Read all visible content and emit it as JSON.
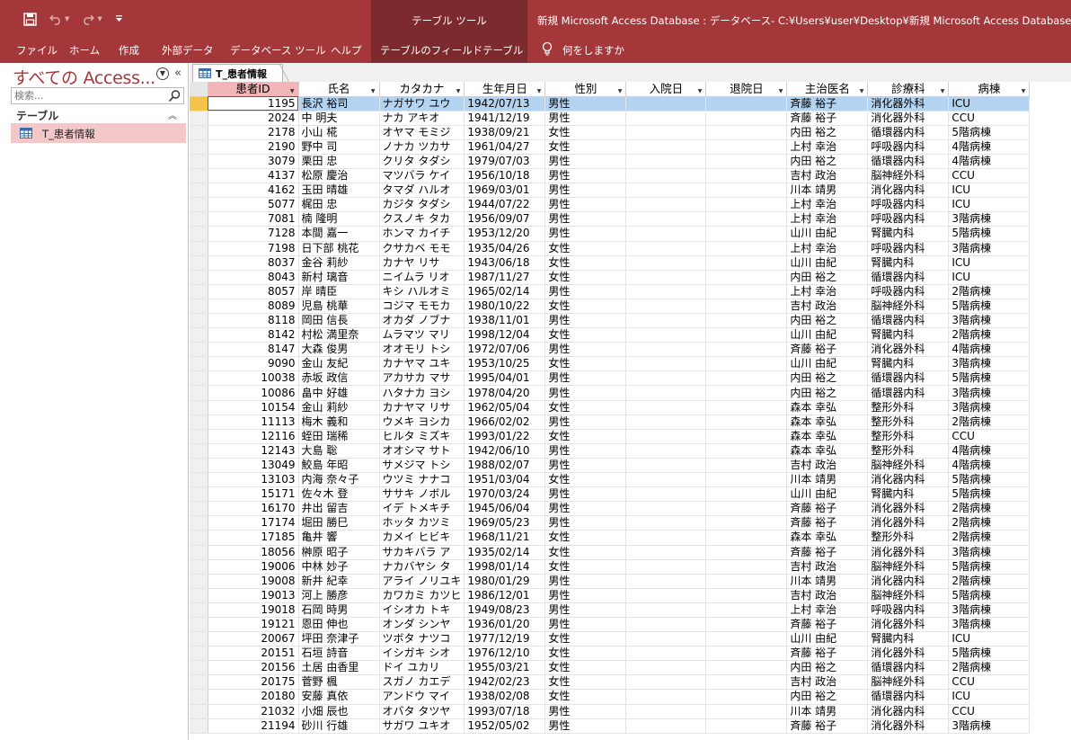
{
  "titlebar": {
    "context_title": "テーブル ツール",
    "window_title": "新規 Microsoft Access Database : データベース- C:¥Users¥user¥Desktop¥新規 Microsoft Access Database.accdb"
  },
  "ribbon": {
    "tabs": [
      "ファイル",
      "ホーム",
      "作成",
      "外部データ",
      "データベース ツール",
      "ヘルプ",
      "テーブルのフィールド",
      "テーブル"
    ],
    "tell_me": "何をしますか"
  },
  "nav": {
    "title": "すべての Access...",
    "search_placeholder": "検索...",
    "group_label": "テーブル",
    "items": [
      {
        "label": "T_患者情報"
      }
    ]
  },
  "document": {
    "tab_label": "T_患者情報"
  },
  "grid": {
    "columns": [
      {
        "label": "患者ID"
      },
      {
        "label": "氏名"
      },
      {
        "label": "カタカナ"
      },
      {
        "label": "生年月日"
      },
      {
        "label": "性別"
      },
      {
        "label": "入院日"
      },
      {
        "label": "退院日"
      },
      {
        "label": "主治医名"
      },
      {
        "label": "診療科"
      },
      {
        "label": "病棟"
      }
    ],
    "rows": [
      [
        "1195",
        "長沢 裕司",
        "ナガサワ ユウ",
        "1942/07/13",
        "男性",
        "",
        "",
        "斉藤 裕子",
        "消化器外科",
        "ICU"
      ],
      [
        "2024",
        "中 明夫",
        "ナカ アキオ",
        "1941/12/19",
        "男性",
        "",
        "",
        "斉藤 裕子",
        "消化器外科",
        "CCU"
      ],
      [
        "2178",
        "小山 椛",
        "オヤマ モミジ",
        "1938/09/21",
        "女性",
        "",
        "",
        "内田 裕之",
        "循環器内科",
        "5階病棟"
      ],
      [
        "2190",
        "野中 司",
        "ノナカ ツカサ",
        "1961/04/27",
        "女性",
        "",
        "",
        "上村 幸治",
        "呼吸器内科",
        "4階病棟"
      ],
      [
        "3079",
        "栗田 忠",
        "クリタ タダシ",
        "1979/07/03",
        "男性",
        "",
        "",
        "内田 裕之",
        "循環器内科",
        "4階病棟"
      ],
      [
        "4137",
        "松原 慶治",
        "マツバラ ケイ",
        "1956/10/18",
        "男性",
        "",
        "",
        "吉村 政治",
        "脳神経外科",
        "CCU"
      ],
      [
        "4162",
        "玉田 晴雄",
        "タマダ ハルオ",
        "1969/03/01",
        "男性",
        "",
        "",
        "川本 靖男",
        "消化器内科",
        "ICU"
      ],
      [
        "5077",
        "梶田 忠",
        "カジタ タダシ",
        "1944/07/22",
        "男性",
        "",
        "",
        "上村 幸治",
        "呼吸器内科",
        "ICU"
      ],
      [
        "7081",
        "楠 隆明",
        "クスノキ タカ",
        "1956/09/07",
        "男性",
        "",
        "",
        "上村 幸治",
        "呼吸器内科",
        "3階病棟"
      ],
      [
        "7128",
        "本間 嘉一",
        "ホンマ カイチ",
        "1953/12/20",
        "男性",
        "",
        "",
        "山川 由紀",
        "腎臓内科",
        "5階病棟"
      ],
      [
        "7198",
        "日下部 桃花",
        "クサカベ モモ",
        "1935/04/26",
        "女性",
        "",
        "",
        "上村 幸治",
        "呼吸器内科",
        "3階病棟"
      ],
      [
        "8037",
        "金谷 莉紗",
        "カナヤ リサ",
        "1943/06/18",
        "女性",
        "",
        "",
        "山川 由紀",
        "腎臓内科",
        "ICU"
      ],
      [
        "8043",
        "新村 璃音",
        "ニイムラ リオ",
        "1987/11/27",
        "女性",
        "",
        "",
        "内田 裕之",
        "循環器内科",
        "ICU"
      ],
      [
        "8057",
        "岸 晴臣",
        "キシ ハルオミ",
        "1965/02/14",
        "男性",
        "",
        "",
        "上村 幸治",
        "呼吸器内科",
        "2階病棟"
      ],
      [
        "8089",
        "児島 桃華",
        "コジマ モモカ",
        "1980/10/22",
        "女性",
        "",
        "",
        "吉村 政治",
        "脳神経外科",
        "5階病棟"
      ],
      [
        "8118",
        "岡田 信長",
        "オカダ ノブナ",
        "1938/11/01",
        "男性",
        "",
        "",
        "内田 裕之",
        "循環器内科",
        "3階病棟"
      ],
      [
        "8142",
        "村松 満里奈",
        "ムラマツ マリ",
        "1998/12/04",
        "女性",
        "",
        "",
        "山川 由紀",
        "腎臓内科",
        "2階病棟"
      ],
      [
        "8147",
        "大森 俊男",
        "オオモリ トシ",
        "1972/07/06",
        "男性",
        "",
        "",
        "斉藤 裕子",
        "消化器外科",
        "4階病棟"
      ],
      [
        "9090",
        "金山 友紀",
        "カナヤマ ユキ",
        "1953/10/25",
        "女性",
        "",
        "",
        "山川 由紀",
        "腎臓内科",
        "3階病棟"
      ],
      [
        "10038",
        "赤坂 政信",
        "アカサカ マサ",
        "1995/04/01",
        "男性",
        "",
        "",
        "内田 裕之",
        "循環器内科",
        "5階病棟"
      ],
      [
        "10086",
        "畠中 好雄",
        "ハタナカ ヨシ",
        "1978/04/20",
        "男性",
        "",
        "",
        "内田 裕之",
        "循環器内科",
        "3階病棟"
      ],
      [
        "10154",
        "金山 莉紗",
        "カナヤマ リサ",
        "1962/05/04",
        "女性",
        "",
        "",
        "森本 幸弘",
        "整形外科",
        "3階病棟"
      ],
      [
        "11113",
        "梅木 義和",
        "ウメキ ヨシカ",
        "1966/02/02",
        "男性",
        "",
        "",
        "森本 幸弘",
        "整形外科",
        "2階病棟"
      ],
      [
        "12116",
        "蛭田 瑞稀",
        "ヒルタ ミズキ",
        "1993/01/22",
        "女性",
        "",
        "",
        "森本 幸弘",
        "整形外科",
        "CCU"
      ],
      [
        "12143",
        "大島 聡",
        "オオシマ サト",
        "1942/06/10",
        "男性",
        "",
        "",
        "森本 幸弘",
        "整形外科",
        "4階病棟"
      ],
      [
        "13049",
        "鮫島 年昭",
        "サメジマ トシ",
        "1988/02/07",
        "男性",
        "",
        "",
        "吉村 政治",
        "脳神経外科",
        "4階病棟"
      ],
      [
        "13103",
        "内海 奈々子",
        "ウツミ ナナコ",
        "1951/03/04",
        "女性",
        "",
        "",
        "川本 靖男",
        "消化器内科",
        "5階病棟"
      ],
      [
        "15171",
        "佐々木 登",
        "ササキ ノボル",
        "1970/03/24",
        "男性",
        "",
        "",
        "山川 由紀",
        "腎臓内科",
        "5階病棟"
      ],
      [
        "16170",
        "井出 留吉",
        "イデ トメキチ",
        "1945/06/04",
        "男性",
        "",
        "",
        "斉藤 裕子",
        "消化器外科",
        "2階病棟"
      ],
      [
        "17174",
        "堀田 勝巳",
        "ホッタ カツミ",
        "1969/05/23",
        "男性",
        "",
        "",
        "斉藤 裕子",
        "消化器外科",
        "2階病棟"
      ],
      [
        "17185",
        "亀井 響",
        "カメイ ヒビキ",
        "1968/11/21",
        "女性",
        "",
        "",
        "森本 幸弘",
        "整形外科",
        "2階病棟"
      ],
      [
        "18056",
        "榊原 昭子",
        "サカキバラ ア",
        "1935/02/14",
        "女性",
        "",
        "",
        "斉藤 裕子",
        "消化器外科",
        "3階病棟"
      ],
      [
        "19006",
        "中林 妙子",
        "ナカバヤシ タ",
        "1998/01/14",
        "女性",
        "",
        "",
        "吉村 政治",
        "脳神経外科",
        "5階病棟"
      ],
      [
        "19008",
        "新井 紀幸",
        "アライ ノリユキ",
        "1980/01/29",
        "男性",
        "",
        "",
        "川本 靖男",
        "消化器内科",
        "2階病棟"
      ],
      [
        "19013",
        "河上 勝彦",
        "カワカミ カツヒ",
        "1986/12/01",
        "男性",
        "",
        "",
        "吉村 政治",
        "脳神経外科",
        "5階病棟"
      ],
      [
        "19018",
        "石岡 時男",
        "イシオカ トキ",
        "1949/08/23",
        "男性",
        "",
        "",
        "上村 幸治",
        "呼吸器内科",
        "3階病棟"
      ],
      [
        "19121",
        "恩田 伸也",
        "オンダ シンヤ",
        "1936/01/20",
        "男性",
        "",
        "",
        "斉藤 裕子",
        "消化器外科",
        "3階病棟"
      ],
      [
        "20067",
        "坪田 奈津子",
        "ツボタ ナツコ",
        "1977/12/19",
        "女性",
        "",
        "",
        "山川 由紀",
        "腎臓内科",
        "ICU"
      ],
      [
        "20151",
        "石垣 詩音",
        "イシガキ シオ",
        "1976/12/10",
        "女性",
        "",
        "",
        "斉藤 裕子",
        "消化器外科",
        "5階病棟"
      ],
      [
        "20156",
        "土居 由香里",
        "ドイ ユカリ",
        "1955/03/21",
        "女性",
        "",
        "",
        "内田 裕之",
        "循環器内科",
        "2階病棟"
      ],
      [
        "20175",
        "菅野 楓",
        "スガノ カエデ",
        "1942/02/23",
        "女性",
        "",
        "",
        "吉村 政治",
        "脳神経外科",
        "CCU"
      ],
      [
        "20180",
        "安藤 真依",
        "アンドウ マイ",
        "1938/02/08",
        "女性",
        "",
        "",
        "内田 裕之",
        "循環器内科",
        "ICU"
      ],
      [
        "21032",
        "小畑 辰也",
        "オバタ タツヤ",
        "1993/07/18",
        "男性",
        "",
        "",
        "川本 靖男",
        "消化器内科",
        "CCU"
      ],
      [
        "21194",
        "砂川 行雄",
        "サガワ ユキオ",
        "1952/05/02",
        "男性",
        "",
        "",
        "斉藤 裕子",
        "消化器外科",
        "3階病棟"
      ]
    ]
  },
  "colors": {
    "accent": "#a4373a",
    "accent_dark": "#7c2a2d",
    "selected_row": "#b3d3f0",
    "selected_header": "#f3b5b8",
    "nav_selected": "#f4c7c9"
  }
}
